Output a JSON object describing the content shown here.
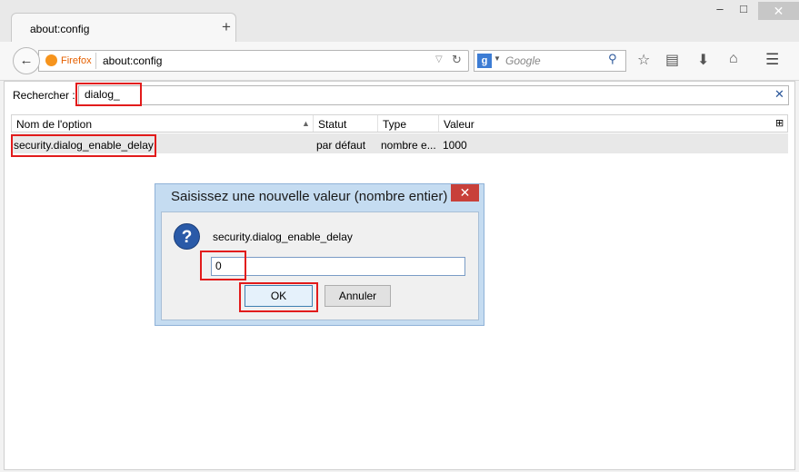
{
  "tab": {
    "title": "about:config",
    "new_tab": "+"
  },
  "window": {
    "minimize": "–",
    "maximize": "□",
    "close": "✕"
  },
  "navbar": {
    "brand": "Firefox",
    "url": "about:config",
    "search_placeholder": "Google",
    "icons": [
      "back-icon",
      "firefox-icon",
      "dropdown-icon",
      "reload-icon",
      "google-icon",
      "search-icon",
      "bookmark-star-icon",
      "bookmarks-list-icon",
      "download-icon",
      "home-icon",
      "menu-icon"
    ]
  },
  "filter": {
    "label": "Rechercher :",
    "value": "dialog_",
    "clear": "✕"
  },
  "table": {
    "headers": [
      "Nom de l'option",
      "Statut",
      "Type",
      "Valeur"
    ],
    "rows": [
      {
        "name": "security.dialog_enable_delay",
        "status": "par défaut",
        "type": "nombre e...",
        "value": "1000"
      }
    ]
  },
  "dialog": {
    "title": "Saisissez une nouvelle valeur (nombre entier)",
    "message": "security.dialog_enable_delay",
    "input_value": "0",
    "ok_label": "OK",
    "cancel_label": "Annuler"
  },
  "colors": {
    "highlight": "#e21b1b",
    "dialog_frame": "#c5dcf1",
    "close_red": "#c8403a",
    "brand": "#e66000"
  }
}
